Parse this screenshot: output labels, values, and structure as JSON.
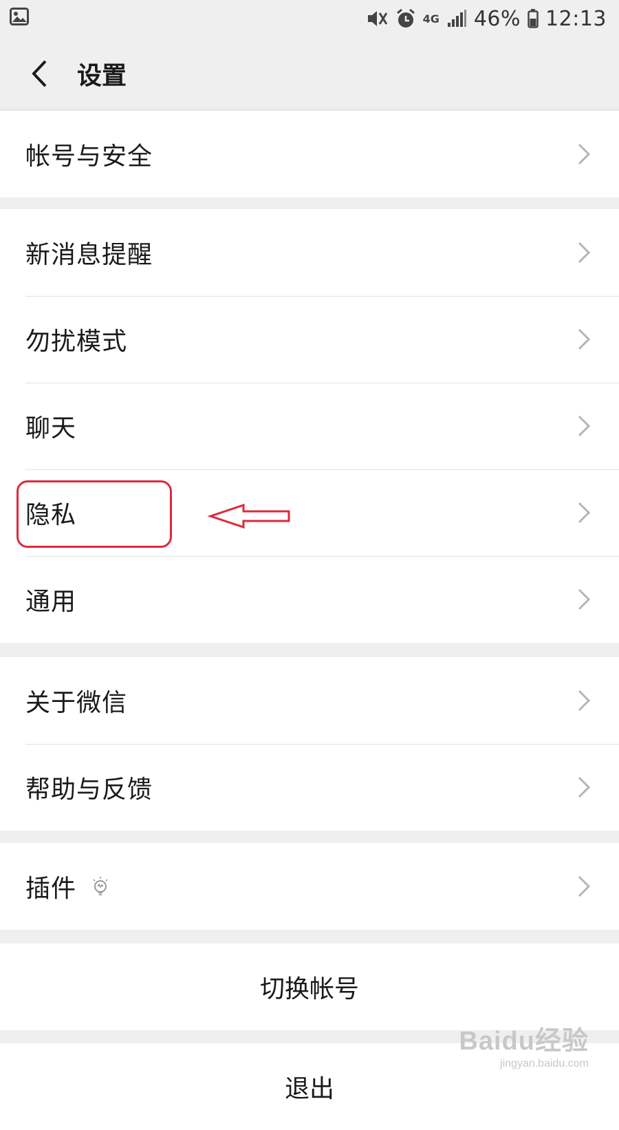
{
  "status_bar": {
    "battery": "46%",
    "time": "12:13",
    "network": "4G",
    "icons": [
      "gallery-icon",
      "mute-vibrate-icon",
      "alarm-icon",
      "signal-icon",
      "battery-icon"
    ]
  },
  "header": {
    "title": "设置",
    "back_icon": "chevron-left-icon"
  },
  "groups": [
    {
      "items": [
        {
          "label": "帐号与安全"
        }
      ]
    },
    {
      "items": [
        {
          "label": "新消息提醒"
        },
        {
          "label": "勿扰模式"
        },
        {
          "label": "聊天"
        },
        {
          "label": "隐私"
        },
        {
          "label": "通用"
        }
      ]
    },
    {
      "items": [
        {
          "label": "关于微信"
        },
        {
          "label": "帮助与反馈"
        }
      ]
    },
    {
      "items": [
        {
          "label": "插件",
          "icon": "lightbulb-icon"
        }
      ]
    }
  ],
  "actions": {
    "switch_account": "切换帐号",
    "logout": "退出"
  },
  "annotation": {
    "highlight_color": "#e0283a",
    "highlighted_item": "隐私"
  },
  "watermark": {
    "brand": "Baidu经验",
    "url": "jingyan.baidu.com"
  },
  "colors": {
    "background": "#efefef",
    "row": "#ffffff",
    "text": "#1a1a1a",
    "chevron": "#b5b5b5"
  }
}
